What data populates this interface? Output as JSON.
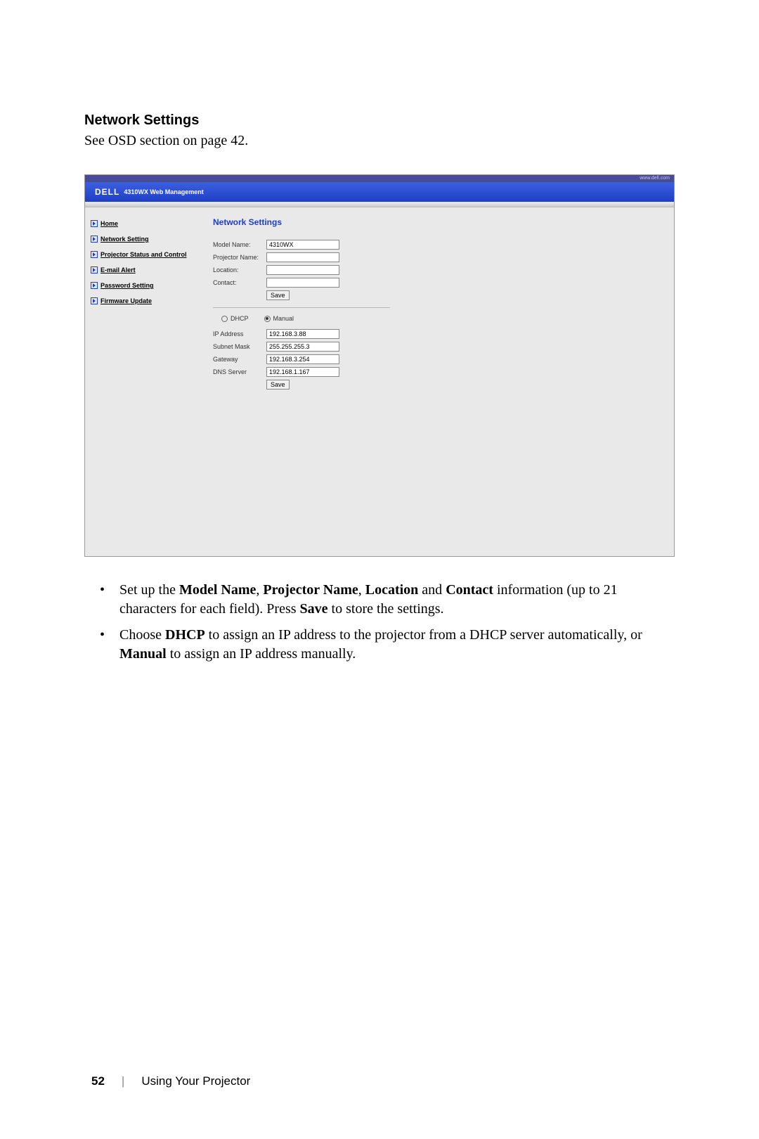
{
  "heading": "Network Settings",
  "intro": "See OSD section on page 42.",
  "screenshot": {
    "topbar_text": "www.dell.com",
    "logo": "DELL",
    "title_suffix": "4310WX Web Management",
    "sidebar": {
      "items": [
        {
          "label": "Home"
        },
        {
          "label": "Network Setting"
        },
        {
          "label": "Projector Status and Control"
        },
        {
          "label": "E-mail Alert"
        },
        {
          "label": "Password Setting"
        },
        {
          "label": "Firmware Update"
        }
      ]
    },
    "content": {
      "title": "Network Settings",
      "group1": {
        "rows": [
          {
            "label": "Model Name:",
            "value": "4310WX"
          },
          {
            "label": "Projector Name:",
            "value": ""
          },
          {
            "label": "Location:",
            "value": ""
          },
          {
            "label": "Contact:",
            "value": ""
          }
        ],
        "save_label": "Save"
      },
      "radio": {
        "dhcp_label": "DHCP",
        "manual_label": "Manual",
        "selected": "manual"
      },
      "group2": {
        "rows": [
          {
            "label": "IP Address",
            "value": "192.168.3.88"
          },
          {
            "label": "Subnet Mask",
            "value": "255.255.255.3"
          },
          {
            "label": "Gateway",
            "value": "192.168.3.254"
          },
          {
            "label": "DNS Server",
            "value": "192.168.1.167"
          }
        ],
        "save_label": "Save"
      }
    }
  },
  "bullets": {
    "b1_pre": "Set up the ",
    "b1_s1": "Model Name",
    "b1_c1": ", ",
    "b1_s2": "Projector Name",
    "b1_c2": ", ",
    "b1_s3": "Location",
    "b1_and": " and ",
    "b1_s4": "Contact",
    "b1_mid": " information (up to 21 characters for each field). Press ",
    "b1_s5": "Save",
    "b1_end": " to store the settings.",
    "b2_pre": "Choose ",
    "b2_s1": "DHCP",
    "b2_mid": " to assign an IP address to the projector from a DHCP server automatically, or ",
    "b2_s2": "Manual",
    "b2_end": " to assign an IP address manually."
  },
  "footer": {
    "page": "52",
    "sep": "|",
    "section": "Using Your Projector"
  }
}
